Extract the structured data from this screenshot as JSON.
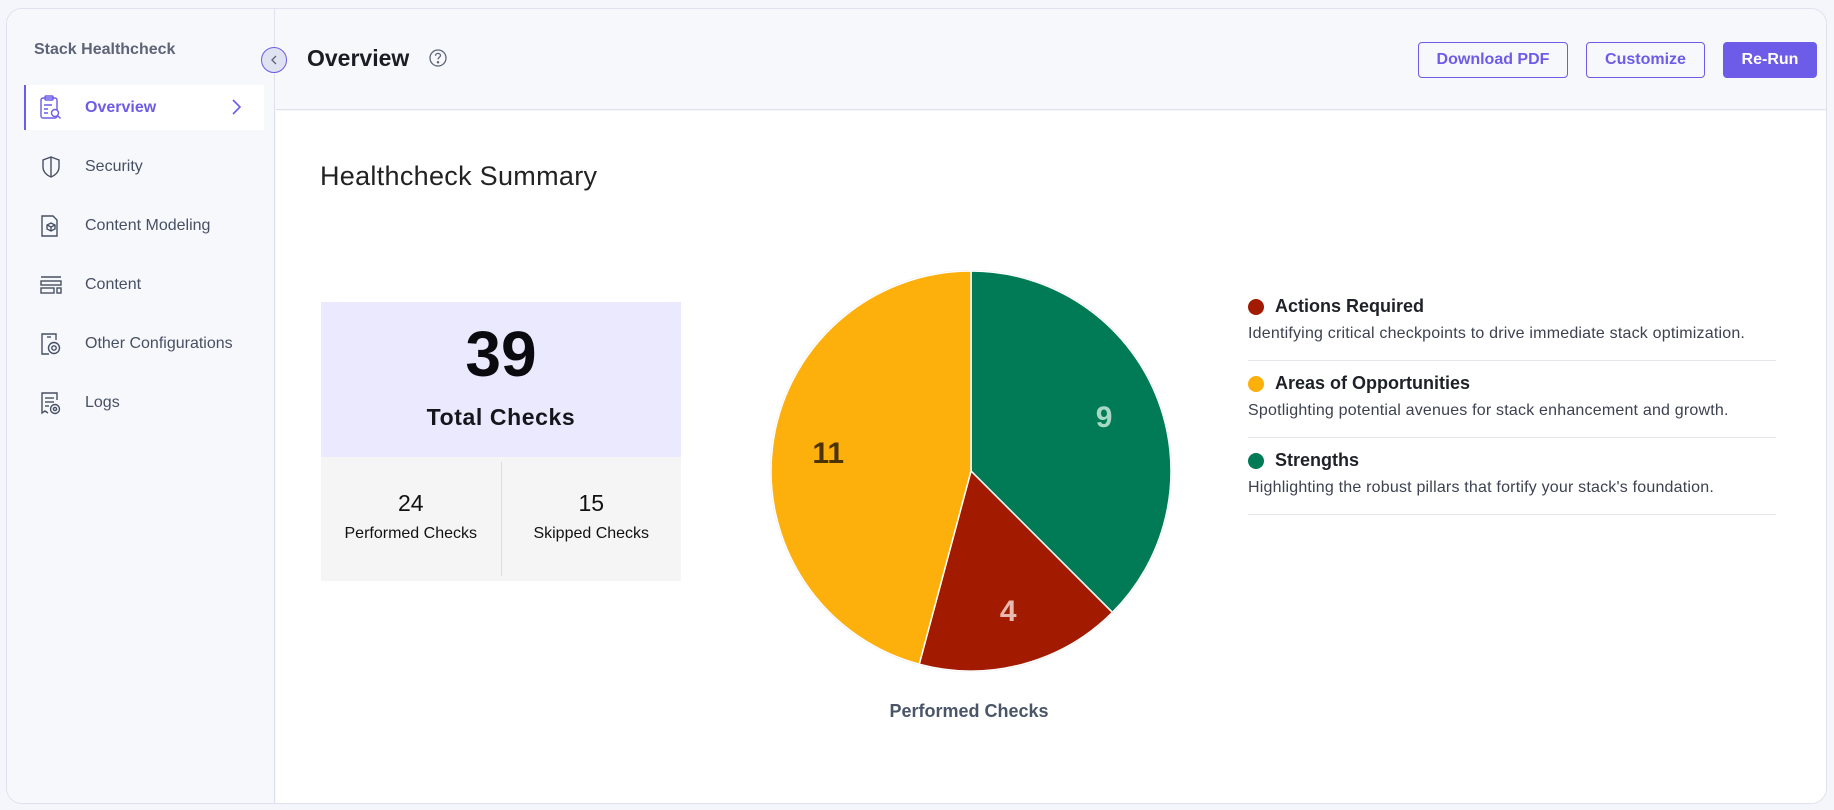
{
  "sidebar": {
    "title": "Stack Healthcheck",
    "items": [
      {
        "label": "Overview",
        "icon": "clipboard-search-icon",
        "active": true
      },
      {
        "label": "Security",
        "icon": "shield-icon",
        "active": false
      },
      {
        "label": "Content Modeling",
        "icon": "cube-document-icon",
        "active": false
      },
      {
        "label": "Content",
        "icon": "content-layout-icon",
        "active": false
      },
      {
        "label": "Other Configurations",
        "icon": "settings-document-icon",
        "active": false
      },
      {
        "label": "Logs",
        "icon": "logs-icon",
        "active": false
      }
    ]
  },
  "header": {
    "title": "Overview",
    "buttons": {
      "download": "Download PDF",
      "customize": "Customize",
      "rerun": "Re-Run"
    }
  },
  "colors": {
    "accent": "#6c5ce7",
    "actions_required": "#a21b00",
    "opportunities": "#fdaf0b",
    "strengths": "#007b55"
  },
  "summary": {
    "title": "Healthcheck Summary",
    "total": {
      "value": "39",
      "label": "Total Checks"
    },
    "performed": {
      "value": "24",
      "label": "Performed Checks"
    },
    "skipped": {
      "value": "15",
      "label": "Skipped Checks"
    }
  },
  "legend": [
    {
      "name": "Actions Required",
      "description": "Identifying critical checkpoints to drive immediate stack optimization.",
      "color": "#a21b00"
    },
    {
      "name": "Areas of Opportunities",
      "description": "Spotlighting potential avenues for stack enhancement and growth.",
      "color": "#fdaf0b"
    },
    {
      "name": "Strengths",
      "description": "Highlighting the robust pillars that fortify your stack's foundation.",
      "color": "#007b55"
    }
  ],
  "chart_data": {
    "type": "pie",
    "title": "Performed Checks",
    "categories": [
      "Strengths",
      "Actions Required",
      "Areas of Opportunities"
    ],
    "values": [
      9,
      4,
      11
    ],
    "colors": [
      "#007b55",
      "#a21b00",
      "#fdaf0b"
    ],
    "label_colors": [
      "#a8d8c4",
      "#e8b9b0",
      "#4a3300"
    ],
    "start_angle": "top, clockwise",
    "legend_position": "right"
  }
}
